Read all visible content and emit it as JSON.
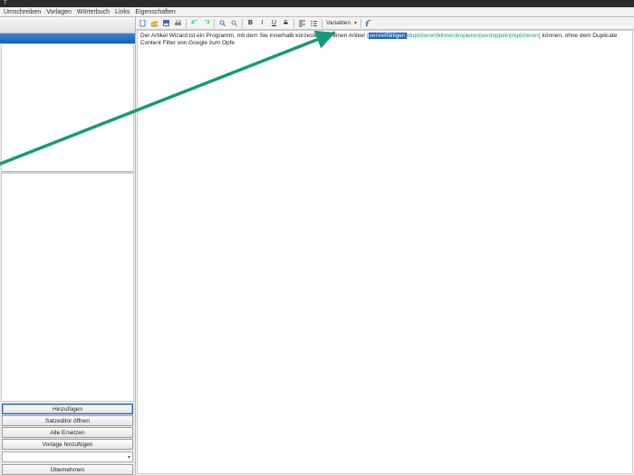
{
  "window": {
    "title": "T"
  },
  "menubar": {
    "rewrite": "Umschreiben",
    "templates": "Vorlagen",
    "dictionary": "Wörterbuch",
    "links": "Links",
    "properties": "Eigenschaften"
  },
  "left": {
    "buttons": {
      "add": "Hinzufügen",
      "open_sentence_editor": "Satzeditor öffnen",
      "replace_all": "Alle Ersetzen",
      "add_template": "Vorlage hinzufügen",
      "apply": "Übernehmen"
    }
  },
  "toolbar": {
    "bold": "B",
    "italic": "I",
    "underline": "U",
    "strike": "S",
    "variables_label": "Variablen"
  },
  "editor": {
    "pre": "Der Artikel Wizard ist ein Programm, mit dem Sie innerhalb kürzester Zeit einen Artikel ",
    "spin_open": "{",
    "spin_first": "vervielfältigen",
    "spin_rest": "|duplizieren|klonen|kopieren|verdoppeln|replizieren}",
    "post": " können, ohne dem Duplicate Content Filter von Google zum Opfe"
  },
  "colors": {
    "accent": "#159a78",
    "highlight": "#1863c7"
  }
}
